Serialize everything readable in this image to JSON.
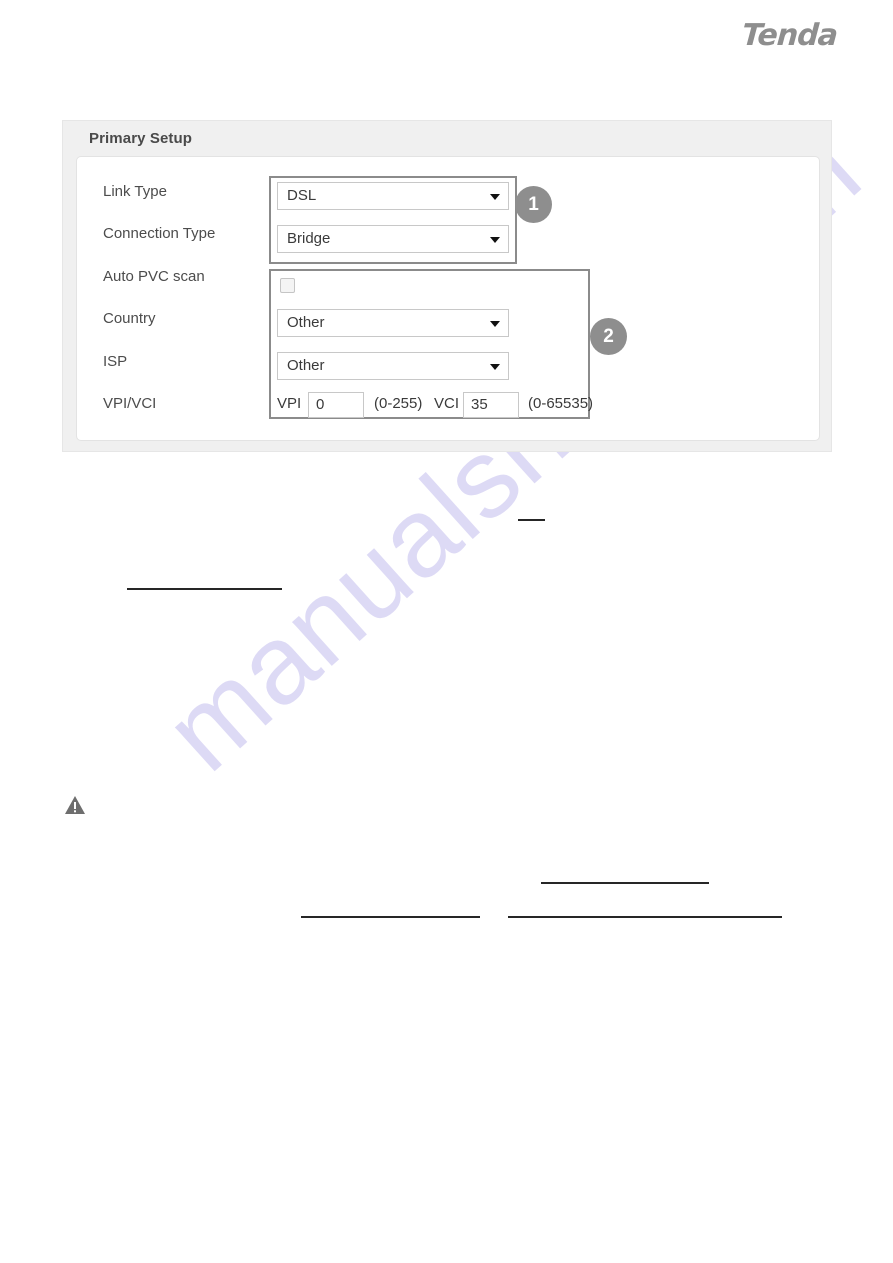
{
  "brand": {
    "logo_text": "Tenda",
    "logo_icon": "tenda-wordmark"
  },
  "watermark": {
    "text": "manualshive.com",
    "color": "#c9c4ef"
  },
  "panel": {
    "title": "Primary Setup",
    "header_bg": "#f0f0f0",
    "body_bg": "#ffffff"
  },
  "form": {
    "rows": [
      {
        "label": "Link Type"
      },
      {
        "label": "Connection Type"
      },
      {
        "label": "Auto PVC scan"
      },
      {
        "label": "Country"
      },
      {
        "label": "ISP"
      },
      {
        "label": "VPI/VCI"
      }
    ],
    "link_type": {
      "label": "Link Type",
      "value": "DSL",
      "caret_icon": "chevron-down-icon"
    },
    "connection_type": {
      "label": "Connection Type",
      "value": "Bridge",
      "caret_icon": "chevron-down-icon"
    },
    "auto_pvc_scan": {
      "label": "Auto PVC scan",
      "checked": false,
      "checkbox_icon": "checkbox-unchecked-icon"
    },
    "country": {
      "label": "Country",
      "value": "Other",
      "caret_icon": "chevron-down-icon"
    },
    "isp": {
      "label": "ISP",
      "value": "Other",
      "caret_icon": "chevron-down-icon"
    },
    "vpi_vci": {
      "label": "VPI/VCI",
      "vpi_label": "VPI",
      "vpi_value": "0",
      "vpi_range": "(0-255)",
      "vci_label": "VCI",
      "vci_value": "35",
      "vci_range": "(0-65535)"
    }
  },
  "callouts": {
    "badge_color": "#8e8e8e",
    "items": [
      {
        "number": "1"
      },
      {
        "number": "2"
      }
    ]
  },
  "notice": {
    "icon": "warning-triangle-icon"
  }
}
